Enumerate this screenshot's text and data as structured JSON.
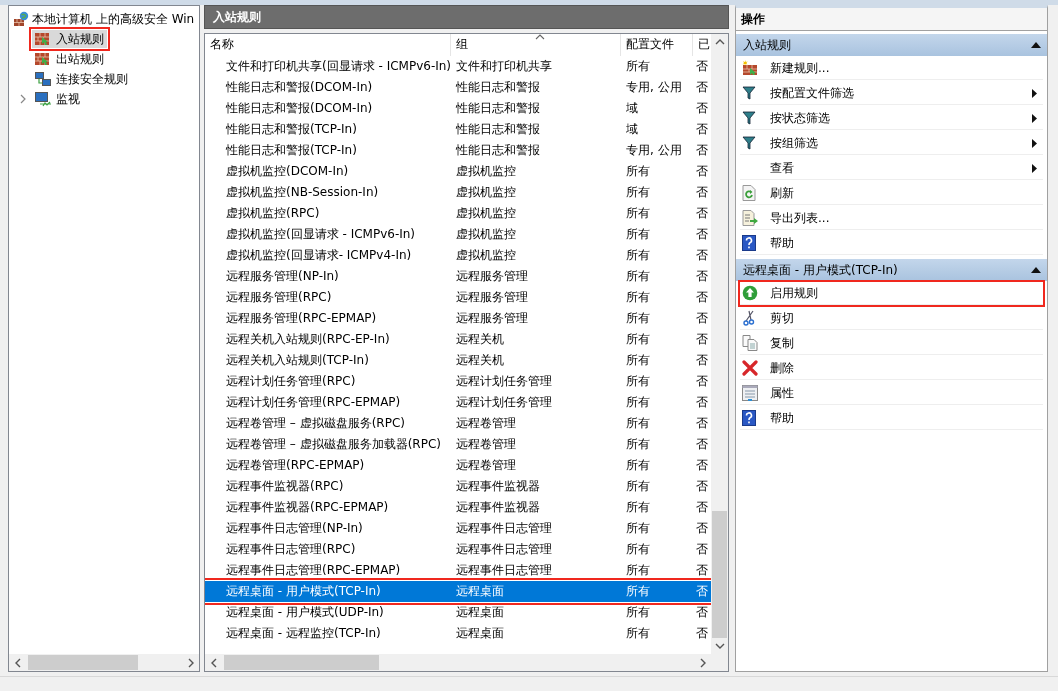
{
  "tree": {
    "root": {
      "label": "本地计算机 上的高级安全 Win",
      "children": [
        {
          "label": "入站规则",
          "selected": true,
          "highlighted": true
        },
        {
          "label": "出站规则",
          "selected": false,
          "highlighted": false
        },
        {
          "label": "连接安全规则",
          "selected": false,
          "highlighted": false
        },
        {
          "label": "监视",
          "selected": false,
          "highlighted": false,
          "expanded": false
        }
      ]
    }
  },
  "rules_panel": {
    "title": "入站规则",
    "columns": [
      "名称",
      "组",
      "配置文件",
      "已"
    ],
    "rows": [
      {
        "name": "文件和打印机共享(回显请求 - ICMPv6-In)",
        "group": "文件和打印机共享",
        "profile": "所有",
        "enabled": "否",
        "selected": false,
        "highlighted": false
      },
      {
        "name": "性能日志和警报(DCOM-In)",
        "group": "性能日志和警报",
        "profile": "专用, 公用",
        "enabled": "否",
        "selected": false,
        "highlighted": false
      },
      {
        "name": "性能日志和警报(DCOM-In)",
        "group": "性能日志和警报",
        "profile": "域",
        "enabled": "否",
        "selected": false,
        "highlighted": false
      },
      {
        "name": "性能日志和警报(TCP-In)",
        "group": "性能日志和警报",
        "profile": "域",
        "enabled": "否",
        "selected": false,
        "highlighted": false
      },
      {
        "name": "性能日志和警报(TCP-In)",
        "group": "性能日志和警报",
        "profile": "专用, 公用",
        "enabled": "否",
        "selected": false,
        "highlighted": false
      },
      {
        "name": "虚拟机监控(DCOM-In)",
        "group": "虚拟机监控",
        "profile": "所有",
        "enabled": "否",
        "selected": false,
        "highlighted": false
      },
      {
        "name": "虚拟机监控(NB-Session-In)",
        "group": "虚拟机监控",
        "profile": "所有",
        "enabled": "否",
        "selected": false,
        "highlighted": false
      },
      {
        "name": "虚拟机监控(RPC)",
        "group": "虚拟机监控",
        "profile": "所有",
        "enabled": "否",
        "selected": false,
        "highlighted": false
      },
      {
        "name": "虚拟机监控(回显请求 - ICMPv6-In)",
        "group": "虚拟机监控",
        "profile": "所有",
        "enabled": "否",
        "selected": false,
        "highlighted": false
      },
      {
        "name": "虚拟机监控(回显请求- ICMPv4-In)",
        "group": "虚拟机监控",
        "profile": "所有",
        "enabled": "否",
        "selected": false,
        "highlighted": false
      },
      {
        "name": "远程服务管理(NP-In)",
        "group": "远程服务管理",
        "profile": "所有",
        "enabled": "否",
        "selected": false,
        "highlighted": false
      },
      {
        "name": "远程服务管理(RPC)",
        "group": "远程服务管理",
        "profile": "所有",
        "enabled": "否",
        "selected": false,
        "highlighted": false
      },
      {
        "name": "远程服务管理(RPC-EPMAP)",
        "group": "远程服务管理",
        "profile": "所有",
        "enabled": "否",
        "selected": false,
        "highlighted": false
      },
      {
        "name": "远程关机入站规则(RPC-EP-In)",
        "group": "远程关机",
        "profile": "所有",
        "enabled": "否",
        "selected": false,
        "highlighted": false
      },
      {
        "name": "远程关机入站规则(TCP-In)",
        "group": "远程关机",
        "profile": "所有",
        "enabled": "否",
        "selected": false,
        "highlighted": false
      },
      {
        "name": "远程计划任务管理(RPC)",
        "group": "远程计划任务管理",
        "profile": "所有",
        "enabled": "否",
        "selected": false,
        "highlighted": false
      },
      {
        "name": "远程计划任务管理(RPC-EPMAP)",
        "group": "远程计划任务管理",
        "profile": "所有",
        "enabled": "否",
        "selected": false,
        "highlighted": false
      },
      {
        "name": "远程卷管理 – 虚拟磁盘服务(RPC)",
        "group": "远程卷管理",
        "profile": "所有",
        "enabled": "否",
        "selected": false,
        "highlighted": false
      },
      {
        "name": "远程卷管理 – 虚拟磁盘服务加载器(RPC)",
        "group": "远程卷管理",
        "profile": "所有",
        "enabled": "否",
        "selected": false,
        "highlighted": false
      },
      {
        "name": "远程卷管理(RPC-EPMAP)",
        "group": "远程卷管理",
        "profile": "所有",
        "enabled": "否",
        "selected": false,
        "highlighted": false
      },
      {
        "name": "远程事件监视器(RPC)",
        "group": "远程事件监视器",
        "profile": "所有",
        "enabled": "否",
        "selected": false,
        "highlighted": false
      },
      {
        "name": "远程事件监视器(RPC-EPMAP)",
        "group": "远程事件监视器",
        "profile": "所有",
        "enabled": "否",
        "selected": false,
        "highlighted": false
      },
      {
        "name": "远程事件日志管理(NP-In)",
        "group": "远程事件日志管理",
        "profile": "所有",
        "enabled": "否",
        "selected": false,
        "highlighted": false
      },
      {
        "name": "远程事件日志管理(RPC)",
        "group": "远程事件日志管理",
        "profile": "所有",
        "enabled": "否",
        "selected": false,
        "highlighted": false
      },
      {
        "name": "远程事件日志管理(RPC-EPMAP)",
        "group": "远程事件日志管理",
        "profile": "所有",
        "enabled": "否",
        "selected": false,
        "highlighted": false
      },
      {
        "name": "远程桌面 - 用户模式(TCP-In)",
        "group": "远程桌面",
        "profile": "所有",
        "enabled": "否",
        "selected": true,
        "highlighted": true
      },
      {
        "name": "远程桌面 - 用户模式(UDP-In)",
        "group": "远程桌面",
        "profile": "所有",
        "enabled": "否",
        "selected": false,
        "highlighted": false
      },
      {
        "name": "远程桌面 - 远程监控(TCP-In)",
        "group": "远程桌面",
        "profile": "所有",
        "enabled": "否",
        "selected": false,
        "highlighted": false
      }
    ]
  },
  "actions_panel": {
    "title": "操作",
    "sections": [
      {
        "title": "入站规则",
        "expanded": true,
        "items": [
          {
            "label": "新建规则...",
            "submenu": false,
            "highlighted": false
          },
          {
            "label": "按配置文件筛选",
            "submenu": true,
            "highlighted": false
          },
          {
            "label": "按状态筛选",
            "submenu": true,
            "highlighted": false
          },
          {
            "label": "按组筛选",
            "submenu": true,
            "highlighted": false
          },
          {
            "label": "查看",
            "submenu": true,
            "highlighted": false
          },
          {
            "label": "刷新",
            "submenu": false,
            "highlighted": false
          },
          {
            "label": "导出列表...",
            "submenu": false,
            "highlighted": false
          },
          {
            "label": "帮助",
            "submenu": false,
            "highlighted": false
          }
        ]
      },
      {
        "title": "远程桌面 - 用户模式(TCP-In)",
        "expanded": true,
        "items": [
          {
            "label": "启用规则",
            "submenu": false,
            "highlighted": true
          },
          {
            "label": "剪切",
            "submenu": false,
            "highlighted": false
          },
          {
            "label": "复制",
            "submenu": false,
            "highlighted": false
          },
          {
            "label": "删除",
            "submenu": false,
            "highlighted": false
          },
          {
            "label": "属性",
            "submenu": false,
            "highlighted": false
          },
          {
            "label": "帮助",
            "submenu": false,
            "highlighted": false
          }
        ]
      }
    ]
  }
}
